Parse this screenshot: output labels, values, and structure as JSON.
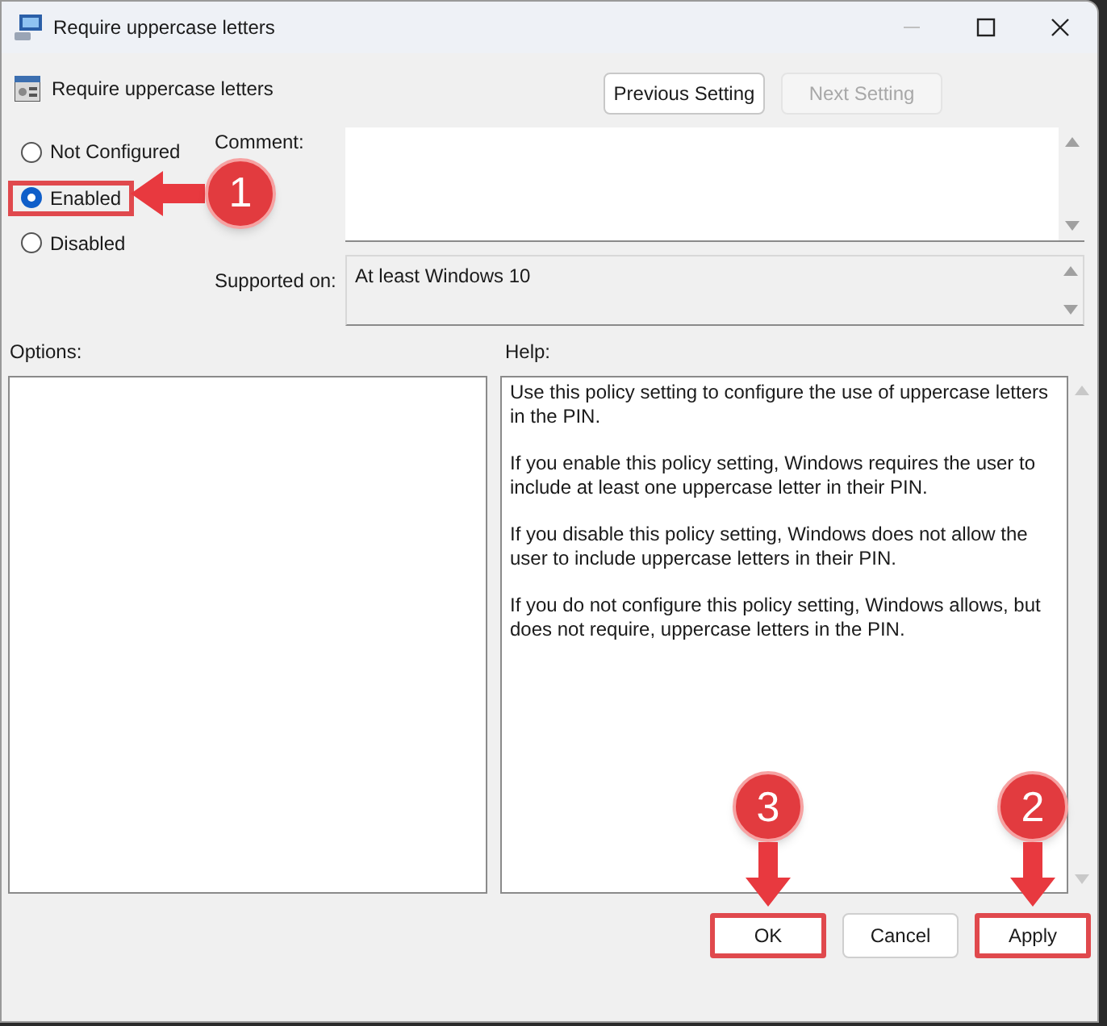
{
  "window": {
    "title": "Require uppercase letters"
  },
  "header": {
    "title": "Require uppercase letters"
  },
  "nav_buttons": [
    {
      "label": "Previous Setting",
      "disabled": false
    },
    {
      "label": "Next Setting",
      "disabled": true
    }
  ],
  "radios": [
    {
      "label": "Not Configured",
      "selected": false,
      "highlighted": false
    },
    {
      "label": "Enabled",
      "selected": true,
      "highlighted": true,
      "callout": "1"
    },
    {
      "label": "Disabled",
      "selected": false,
      "highlighted": false
    }
  ],
  "comment": {
    "label": "Comment:"
  },
  "supported_on": {
    "label": "Supported on:",
    "value": "At least Windows 10"
  },
  "options": {
    "label": "Options:"
  },
  "help": {
    "label": "Help:",
    "paragraphs": [
      "Use this policy setting to configure the use of uppercase letters in the PIN.",
      "If you enable this policy setting, Windows requires the user to include at least one uppercase letter in their PIN.",
      "If you disable this policy setting, Windows does not allow the user to include uppercase letters in their PIN.",
      "If you do not configure this policy setting, Windows allows, but does not require, uppercase letters in the PIN."
    ]
  },
  "buttons": [
    {
      "label": "OK",
      "highlighted": true,
      "callout": "3"
    },
    {
      "label": "Cancel",
      "highlighted": false
    },
    {
      "label": "Apply",
      "highlighted": true,
      "callout": "2"
    }
  ]
}
